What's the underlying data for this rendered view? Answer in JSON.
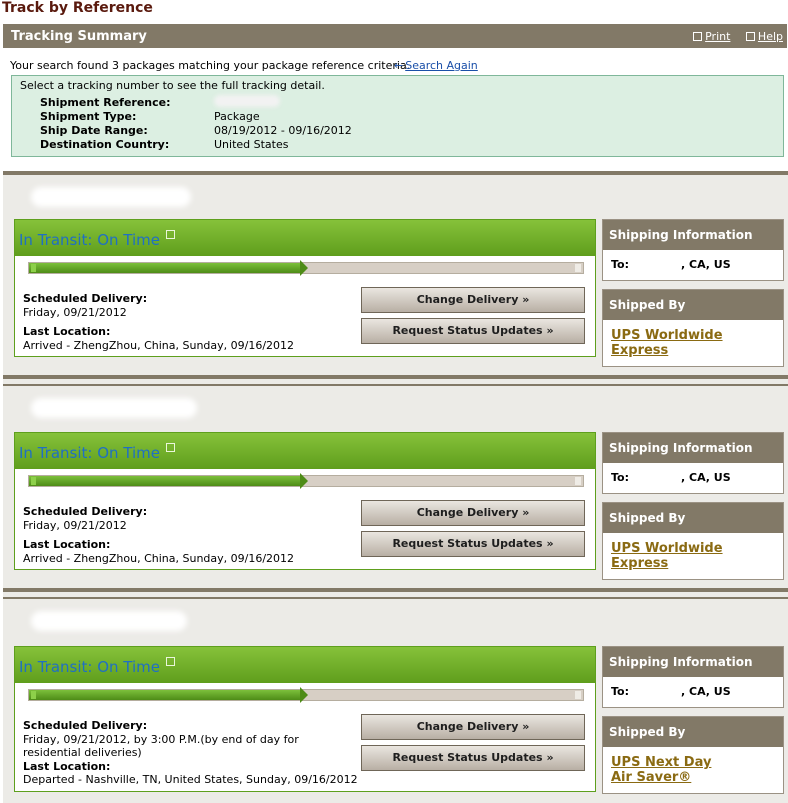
{
  "page": {
    "title": "Track by Reference"
  },
  "summary": {
    "title": "Tracking Summary",
    "print_label": "Print",
    "help_label": "Help",
    "found_text": "Your search found 3 packages matching your package reference criteria.",
    "search_again_label": "Search Again",
    "hint": "Select a tracking number to see the full tracking detail.",
    "fields": [
      {
        "label": "Shipment Reference:",
        "value": ""
      },
      {
        "label": "Shipment Type:",
        "value": "Package"
      },
      {
        "label": "Ship Date Range:",
        "value": "08/19/2012 - 09/16/2012"
      },
      {
        "label": "Destination Country:",
        "value": "United States"
      }
    ]
  },
  "packages": [
    {
      "status": "In Transit: On Time",
      "progress": 0.49,
      "scheduled_label": "Scheduled Delivery:",
      "scheduled_value": "Friday, 09/21/2012",
      "last_label": "Last Location:",
      "last_value": "Arrived - ZhengZhou, China, Sunday, 09/16/2012",
      "change_label": "Change Delivery »",
      "request_label": "Request Status Updates »",
      "ship_info_header": "Shipping Information",
      "to_label": "To:",
      "to_value": ", CA, US",
      "shipped_by_header": "Shipped By",
      "service_line1": "UPS Worldwide",
      "service_line2": "Express"
    },
    {
      "status": "In Transit: On Time",
      "progress": 0.49,
      "scheduled_label": "Scheduled Delivery:",
      "scheduled_value": "Friday, 09/21/2012",
      "last_label": "Last Location:",
      "last_value": "Arrived - ZhengZhou, China, Sunday, 09/16/2012",
      "change_label": "Change Delivery »",
      "request_label": "Request Status Updates »",
      "ship_info_header": "Shipping Information",
      "to_label": "To:",
      "to_value": ", CA, US",
      "shipped_by_header": "Shipped By",
      "service_line1": "UPS Worldwide",
      "service_line2": "Express"
    },
    {
      "status": "In Transit: On Time",
      "progress": 0.49,
      "scheduled_label": "Scheduled Delivery:",
      "scheduled_value": "Friday, 09/21/2012, by 3:00 P.M.(by end of day for residential deliveries)",
      "last_label": "Last Location:",
      "last_value": "Departed - Nashville, TN, United States, Sunday, 09/16/2012",
      "change_label": "Change Delivery »",
      "request_label": "Request Status Updates »",
      "ship_info_header": "Shipping Information",
      "to_label": "To:",
      "to_value": ", CA, US",
      "shipped_by_header": "Shipped By",
      "service_line1": "UPS Next Day",
      "service_line2": "Air Saver®"
    }
  ]
}
